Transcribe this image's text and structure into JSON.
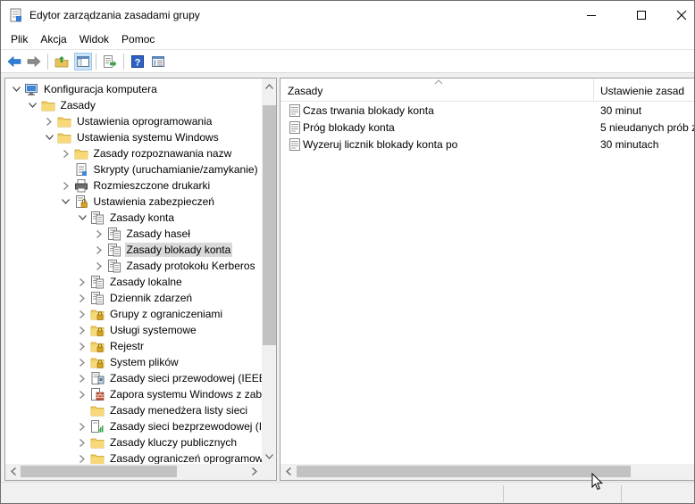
{
  "window": {
    "title": "Edytor zarządzania zasadami grupy",
    "controls": [
      "minimize",
      "maximize",
      "close"
    ]
  },
  "menu": [
    "Plik",
    "Akcja",
    "Widok",
    "Pomoc"
  ],
  "toolbar": {
    "buttons": [
      "back-arrow-icon",
      "forward-arrow-icon",
      "up-folder-icon",
      "show-hide-tree-icon",
      "export-list-icon",
      "help-icon",
      "properties-icon"
    ]
  },
  "tree": {
    "items": [
      {
        "label": "Konfiguracja komputera",
        "expander": "expanded",
        "icon": "computer-icon"
      },
      {
        "label": "Zasady",
        "expander": "expanded",
        "icon": "folder-icon"
      },
      {
        "label": "Ustawienia oprogramowania",
        "expander": "collapsed",
        "icon": "folder-icon"
      },
      {
        "label": "Ustawienia systemu Windows",
        "expander": "expanded",
        "icon": "folder-icon"
      },
      {
        "label": "Zasady rozpoznawania nazw",
        "expander": "collapsed",
        "icon": "folder-icon"
      },
      {
        "label": "Skrypty (uruchamianie/zamykanie)",
        "expander": "none",
        "icon": "script-icon"
      },
      {
        "label": "Rozmieszczone drukarki",
        "expander": "collapsed",
        "icon": "printer-icon"
      },
      {
        "label": "Ustawienia zabezpieczeń",
        "expander": "expanded",
        "icon": "security-settings-icon"
      },
      {
        "label": "Zasady konta",
        "expander": "expanded",
        "icon": "policy-icon"
      },
      {
        "label": "Zasady haseł",
        "expander": "collapsed",
        "icon": "policy-icon"
      },
      {
        "label": "Zasady blokady konta",
        "expander": "collapsed",
        "icon": "policy-icon",
        "selected": true
      },
      {
        "label": "Zasady protokołu Kerberos",
        "expander": "collapsed",
        "icon": "policy-icon"
      },
      {
        "label": "Zasady lokalne",
        "expander": "collapsed",
        "icon": "policy-icon"
      },
      {
        "label": "Dziennik zdarzeń",
        "expander": "collapsed",
        "icon": "policy-icon"
      },
      {
        "label": "Grupy z ograniczeniami",
        "expander": "collapsed",
        "icon": "locked-folder-icon"
      },
      {
        "label": "Usługi systemowe",
        "expander": "collapsed",
        "icon": "locked-folder-icon"
      },
      {
        "label": "Rejestr",
        "expander": "collapsed",
        "icon": "locked-folder-icon"
      },
      {
        "label": "System plików",
        "expander": "collapsed",
        "icon": "locked-folder-icon"
      },
      {
        "label": "Zasady sieci przewodowej (IEEE",
        "expander": "collapsed",
        "icon": "wired-network-icon"
      },
      {
        "label": "Zapora systemu Windows z zab",
        "expander": "collapsed",
        "icon": "firewall-icon"
      },
      {
        "label": "Zasady menedżera listy sieci",
        "expander": "none",
        "icon": "folder-icon"
      },
      {
        "label": "Zasady sieci bezprzewodowej (I",
        "expander": "collapsed",
        "icon": "wireless-network-icon"
      },
      {
        "label": "Zasady kluczy publicznych",
        "expander": "collapsed",
        "icon": "folder-icon"
      },
      {
        "label": "Zasady ograniczeń oprogramow",
        "expander": "collapsed",
        "icon": "folder-icon"
      }
    ]
  },
  "list": {
    "columns": [
      "Zasady",
      "Ustawienie zasad"
    ],
    "rows": [
      {
        "policy": "Czas trwania blokady konta",
        "setting": "30 minut"
      },
      {
        "policy": "Próg blokady konta",
        "setting": "5 nieudanych prób z"
      },
      {
        "policy": "Wyzeruj licznik blokady konta po",
        "setting": "30 minutach"
      }
    ]
  }
}
